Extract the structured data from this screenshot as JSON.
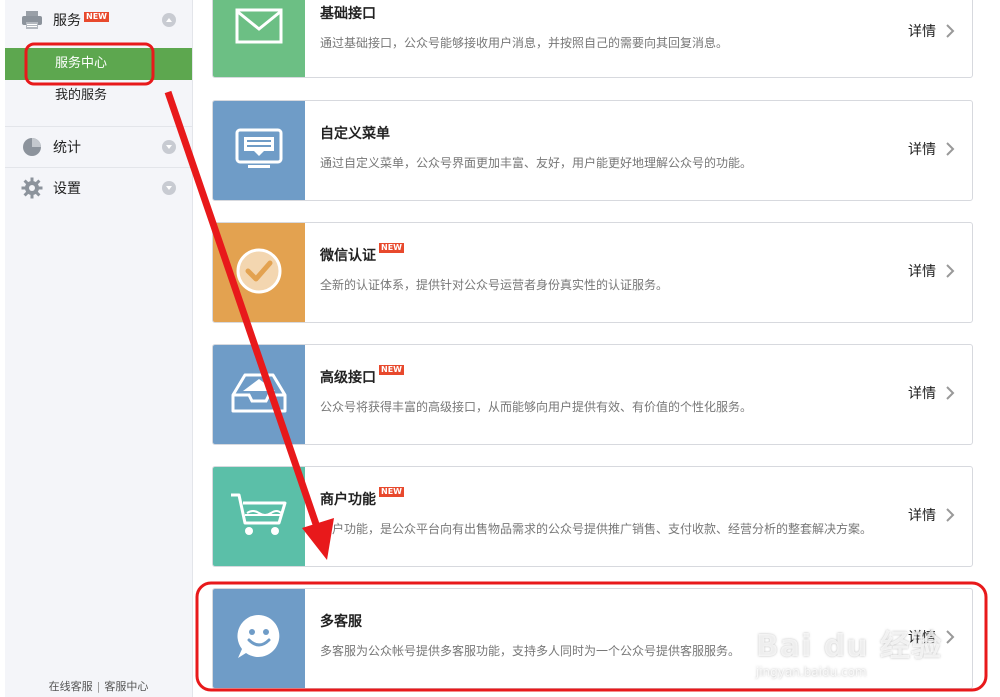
{
  "sidebar": {
    "groups": [
      {
        "label": "服务",
        "badge": "NEW",
        "icon": "printer-icon",
        "expanded": true,
        "items": [
          {
            "label": "服务中心",
            "active": true
          },
          {
            "label": "我的服务",
            "active": false
          }
        ]
      },
      {
        "label": "统计",
        "icon": "pie-chart-icon",
        "expanded": false
      },
      {
        "label": "设置",
        "icon": "gear-icon",
        "expanded": false
      }
    ],
    "footer": {
      "link1": "在线客服",
      "separator": "|",
      "link2": "客服中心"
    }
  },
  "cards": [
    {
      "title": "基础接口",
      "badge": "",
      "desc": "通过基础接口，公众号能够接收用户消息，并按照自己的需要向其回复消息。",
      "link": "详情",
      "icon": "envelope-icon",
      "color": "#6cbf84"
    },
    {
      "title": "自定义菜单",
      "badge": "",
      "desc": "通过自定义菜单，公众号界面更加丰富、友好，用户能更好地理解公众号的功能。",
      "link": "详情",
      "icon": "monitor-icon",
      "color": "#6f9cc7"
    },
    {
      "title": "微信认证",
      "badge": "NEW",
      "desc": "全新的认证体系，提供针对公众号运营者身份真实性的认证服务。",
      "link": "详情",
      "icon": "checkmark-icon",
      "color": "#e3a250"
    },
    {
      "title": "高级接口",
      "badge": "NEW",
      "desc": "公众号将获得丰富的高级接口，从而能够向用户提供有效、有价值的个性化服务。",
      "link": "详情",
      "icon": "inbox-tray-icon",
      "color": "#6f9cc7"
    },
    {
      "title": "商户功能",
      "badge": "NEW",
      "desc": "商户功能，是公众平台向有出售物品需求的公众号提供推广销售、支付收款、经营分析的整套解决方案。",
      "link": "详情",
      "icon": "shopping-cart-icon",
      "color": "#5bbfa8"
    },
    {
      "title": "多客服",
      "badge": "",
      "desc": "多客服为公众帐号提供多客服功能，支持多人同时为一个公众号提供客服服务。",
      "link": "详情",
      "icon": "smiley-chat-icon",
      "color": "#6f9cc7"
    }
  ],
  "watermark": {
    "brand": "Bai du 经验",
    "url": "jingyan.baidu.com"
  },
  "colors": {
    "active_green": "#5da74f",
    "annotation_red": "#e8191b",
    "badge_red": "#e8492d"
  }
}
